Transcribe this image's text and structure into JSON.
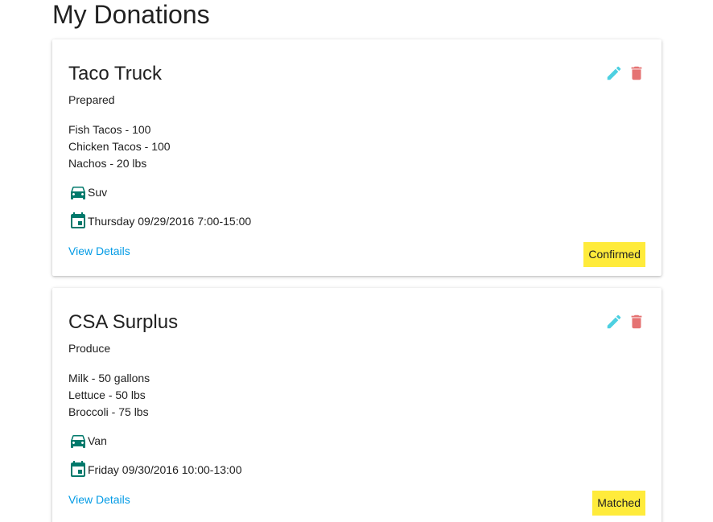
{
  "page": {
    "title": "My Donations"
  },
  "colors": {
    "accent_teal": "#00796b",
    "edit_icon": "#4dd0e1",
    "delete_icon": "#e57373",
    "link": "#039be5",
    "status_badge_bg": "#ffeb3b"
  },
  "donations": [
    {
      "title": "Taco Truck",
      "category": "Prepared",
      "items": [
        "Fish Tacos - 100",
        "Chicken Tacos - 100",
        "Nachos - 20 lbs"
      ],
      "vehicle": "Suv",
      "vehicle_icon": "car-icon",
      "pickup_time": "Thursday 09/29/2016 7:00-15:00",
      "pickup_icon": "calendar-icon",
      "view_details_label": "View Details",
      "status": "Confirmed",
      "edit_icon": "pencil-icon",
      "delete_icon": "trash-icon"
    },
    {
      "title": "CSA Surplus",
      "category": "Produce",
      "items": [
        "Milk - 50 gallons",
        "Lettuce - 50 lbs",
        "Broccoli - 75 lbs"
      ],
      "vehicle": "Van",
      "vehicle_icon": "car-icon",
      "pickup_time": "Friday 09/30/2016 10:00-13:00",
      "pickup_icon": "calendar-icon",
      "view_details_label": "View Details",
      "status": "Matched",
      "edit_icon": "pencil-icon",
      "delete_icon": "trash-icon"
    }
  ]
}
